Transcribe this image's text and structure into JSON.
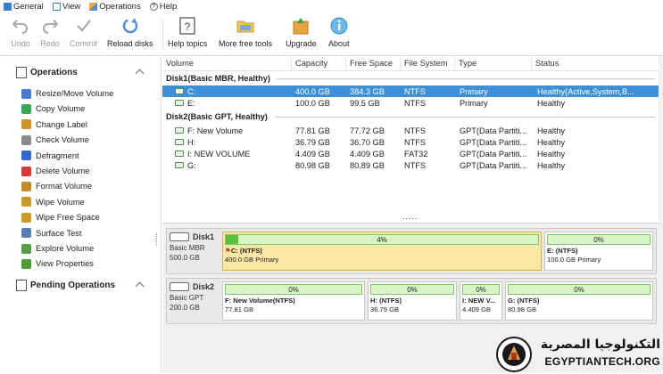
{
  "menu": [
    {
      "label": "General",
      "icon": "general-icon"
    },
    {
      "label": "View",
      "icon": "view-icon"
    },
    {
      "label": "Operations",
      "icon": "operations-icon"
    },
    {
      "label": "Help",
      "icon": "help-icon"
    }
  ],
  "toolbar": {
    "undo": "Undo",
    "redo": "Redo",
    "commit": "Commit",
    "reload": "Reload disks",
    "help_topics": "Help topics",
    "free_tools": "More free tools",
    "upgrade": "Upgrade",
    "about": "About"
  },
  "sidebar": {
    "operations_title": "Operations",
    "items": [
      {
        "label": "Resize/Move Volume",
        "icon": "resize-icon",
        "color": "#4a7bd0"
      },
      {
        "label": "Copy Volume",
        "icon": "copy-icon",
        "color": "#3ba55d"
      },
      {
        "label": "Change Label",
        "icon": "label-icon",
        "color": "#d0932c"
      },
      {
        "label": "Check Volume",
        "icon": "check-icon",
        "color": "#8a8a8a"
      },
      {
        "label": "Defragment",
        "icon": "defragment-icon",
        "color": "#3367c9"
      },
      {
        "label": "Delete Volume",
        "icon": "delete-icon",
        "color": "#d03b3b"
      },
      {
        "label": "Format Volume",
        "icon": "format-icon",
        "color": "#c28b2c"
      },
      {
        "label": "Wipe Volume",
        "icon": "wipe-icon",
        "color": "#c79b30"
      },
      {
        "label": "Wipe Free Space",
        "icon": "wipe-free-icon",
        "color": "#c79b30"
      },
      {
        "label": "Surface Test",
        "icon": "surface-test-icon",
        "color": "#5b7fb0"
      },
      {
        "label": "Explore Volume",
        "icon": "explore-icon",
        "color": "#5c9a4e"
      },
      {
        "label": "View Properties",
        "icon": "properties-icon",
        "color": "#4e9a3c"
      }
    ],
    "pending_title": "Pending Operations"
  },
  "table": {
    "headers": [
      "Volume",
      "Capacity",
      "Free Space",
      "File System",
      "Type",
      "Status"
    ],
    "disk1_label": "Disk1(Basic MBR, Healthy)",
    "disk2_label": "Disk2(Basic GPT, Healthy)",
    "disk1_rows": [
      {
        "volume": "C:",
        "capacity": "400.0 GB",
        "free": "384.3 GB",
        "fs": "NTFS",
        "type": "Primary",
        "status": "Healthy(Active,System,B..."
      },
      {
        "volume": "E:",
        "capacity": "100.0 GB",
        "free": "99.5 GB",
        "fs": "NTFS",
        "type": "Primary",
        "status": "Healthy"
      }
    ],
    "disk2_rows": [
      {
        "volume": "F: New Volume",
        "capacity": "77.81 GB",
        "free": "77.72 GB",
        "fs": "NTFS",
        "type": "GPT(Data Partiti...",
        "status": "Healthy"
      },
      {
        "volume": "H:",
        "capacity": "36.79 GB",
        "free": "36.70 GB",
        "fs": "NTFS",
        "type": "GPT(Data Partiti...",
        "status": "Healthy"
      },
      {
        "volume": "I: NEW VOLUME",
        "capacity": "4.409 GB",
        "free": "4.409 GB",
        "fs": "FAT32",
        "type": "GPT(Data Partiti...",
        "status": "Healthy"
      },
      {
        "volume": "G:",
        "capacity": "80.98 GB",
        "free": "80.89 GB",
        "fs": "NTFS",
        "type": "GPT(Data Partiti...",
        "status": "Healthy"
      }
    ],
    "more": "....."
  },
  "diskmap": {
    "disk1": {
      "name": "Disk1",
      "type": "Basic MBR",
      "size": "500.0 GB",
      "partitions": [
        {
          "pct": "4%",
          "used": 0.04,
          "name": "C: (NTFS)",
          "detail": "400.0 GB Primary"
        },
        {
          "pct": "0%",
          "used": 0.0,
          "name": "E: (NTFS)",
          "detail": "100.0 GB Primary"
        }
      ]
    },
    "disk2": {
      "name": "Disk2",
      "type": "Basic GPT",
      "size": "200.0 GB",
      "partitions": [
        {
          "pct": "0%",
          "used": 0.0,
          "name": "F: New Volume(NTFS)",
          "detail": "77.81 GB"
        },
        {
          "pct": "0%",
          "used": 0.0,
          "name": "H: (NTFS)",
          "detail": "36.79 GB"
        },
        {
          "pct": "0%",
          "used": 0.0,
          "name": "I: NEW V...",
          "detail": "4.409 GB"
        },
        {
          "pct": "0%",
          "used": 0.0,
          "name": "G: (NTFS)",
          "detail": "80.98 GB"
        }
      ]
    }
  },
  "watermark": {
    "arabic": "التكنولوجيا المصرية",
    "latin": "EGYPTIANTECH.ORG"
  }
}
